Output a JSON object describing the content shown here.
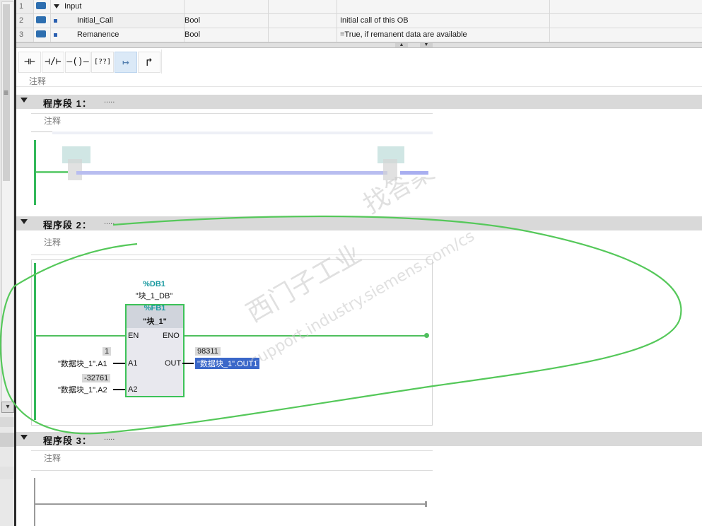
{
  "interface": {
    "rows": [
      {
        "num": "1",
        "name": "Input",
        "type": "",
        "comment": ""
      },
      {
        "num": "2",
        "name": "Initial_Call",
        "type": "Bool",
        "comment": "Initial call of this OB"
      },
      {
        "num": "3",
        "name": "Remanence",
        "type": "Bool",
        "comment": "=True, if remanent data are available"
      }
    ]
  },
  "toolbar": {
    "buttons": [
      {
        "name": "no-contact-button",
        "icon": "normally-open-contact-icon",
        "glyph": "⊣⊢"
      },
      {
        "name": "nc-contact-button",
        "icon": "normally-closed-contact-icon",
        "glyph": "⊣/⊢"
      },
      {
        "name": "coil-button",
        "icon": "coil-icon",
        "glyph": "–()–"
      },
      {
        "name": "empty-box-button",
        "icon": "empty-box-icon",
        "glyph": "[??]"
      },
      {
        "name": "open-branch-button",
        "icon": "open-branch-icon",
        "glyph": "↦"
      },
      {
        "name": "close-branch-button",
        "icon": "close-branch-icon",
        "glyph": "↱"
      }
    ]
  },
  "block_comment": "注释",
  "segments": [
    {
      "title": "程序段 1：",
      "dots": ".....",
      "comment": "注释"
    },
    {
      "title": "程序段 2：",
      "dots": ".....",
      "comment": "注释"
    },
    {
      "title": "程序段 3：",
      "dots": ".....",
      "comment": "注释"
    }
  ],
  "fb_call": {
    "db_address": "%DB1",
    "db_name": "\"块_1_DB\"",
    "fb_address": "%FB1",
    "fb_name": "\"块_1\"",
    "pin_en": "EN",
    "pin_eno": "ENO",
    "pin_a1": "A1",
    "pin_a2": "A2",
    "pin_out": "OUT",
    "a1_value": "1",
    "a1_operand": "\"数据块_1\".A1",
    "a2_value": "-32761",
    "a2_operand": "\"数据块_1\".A2",
    "out_value": "98311",
    "out_operand": "\"数据块_1\".OUT1"
  },
  "watermark": {
    "line1": "西门子工业",
    "line2": "找答案",
    "line3": "support.industry.siemens.com/cs"
  },
  "colors": {
    "rail_green": "#33b85a",
    "segment_header": "#d9d9d9",
    "teal_label": "#1a9aa0",
    "selection": "#3a67c9",
    "annotation_green": "#55c85a"
  },
  "scroll": {
    "down_glyph": "▾",
    "grip_glyph": "≡"
  }
}
